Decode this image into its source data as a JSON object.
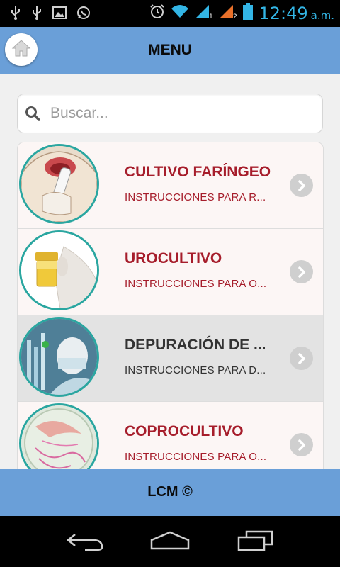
{
  "status_bar": {
    "time": "12:49",
    "ampm": "a.m."
  },
  "header": {
    "title": "MENU"
  },
  "search": {
    "placeholder": "Buscar..."
  },
  "items": [
    {
      "title": "CULTIVO FARÍNGEO",
      "subtitle": "INSTRUCCIONES PARA R..."
    },
    {
      "title": "UROCULTIVO",
      "subtitle": "INSTRUCCIONES PARA O..."
    },
    {
      "title": "DEPURACIÓN DE ...",
      "subtitle": "INSTRUCCIONES PARA D..."
    },
    {
      "title": "COPROCULTIVO",
      "subtitle": "INSTRUCCIONES PARA O..."
    }
  ],
  "footer": {
    "text": "LCM ©"
  },
  "colors": {
    "header_bg": "#6a9fd8",
    "title_red": "#a61d2b",
    "thumb_border": "#2aa6a0",
    "status_accent": "#33b5e5"
  }
}
